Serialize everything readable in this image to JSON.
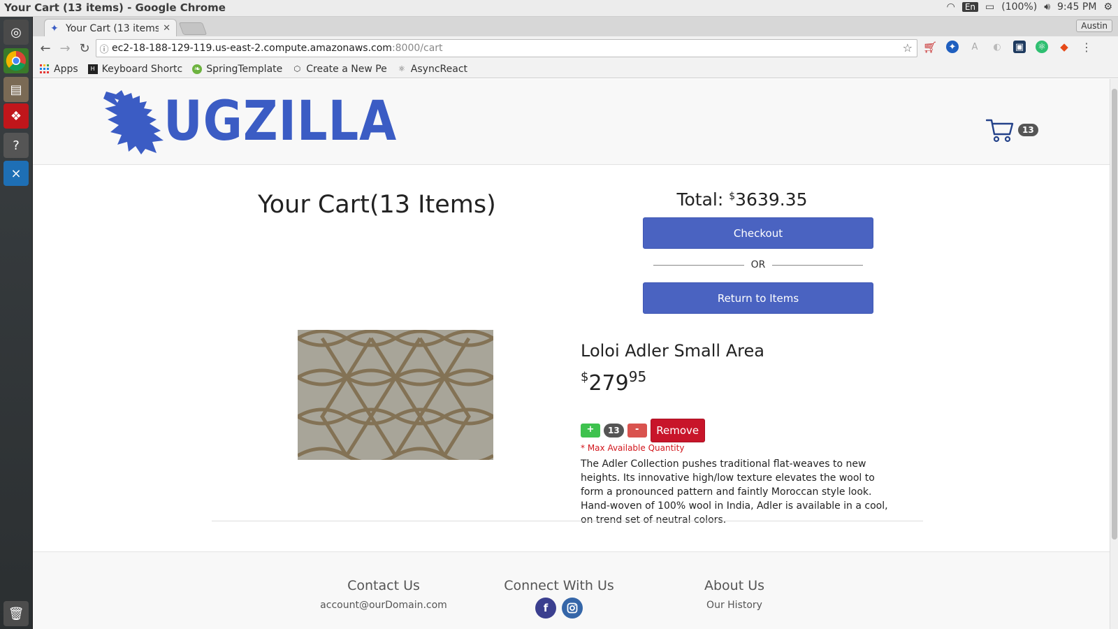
{
  "system": {
    "window_title": "Your Cart (13 items) - Google Chrome",
    "lang": "En",
    "battery": "(100%)",
    "clock": "9:45 PM"
  },
  "browser": {
    "tab_title": "Your Cart (13 items",
    "profile": "Austin",
    "url_host": "ec2-18-188-129-119.us-east-2.compute.amazonaws.com",
    "url_path": ":8000/cart",
    "bookmarks": [
      {
        "label": "Apps"
      },
      {
        "label": "Keyboard Shortc"
      },
      {
        "label": "SpringTemplate"
      },
      {
        "label": "Create a New Pe"
      },
      {
        "label": "AsyncReact"
      }
    ]
  },
  "header": {
    "brand": "UGZILLA",
    "cart_count": "13",
    "brand_color": "#3b5cc4"
  },
  "cart": {
    "title": "Your Cart(13 Items)",
    "total_label": "Total: ",
    "total_currency": "$",
    "total_value": "3639.35",
    "checkout_label": "Checkout",
    "or_label": "OR",
    "return_label": "Return to Items"
  },
  "item": {
    "name": "Loloi Adler Small Area",
    "price_currency": "$",
    "price_whole": "279",
    "price_cents": "95",
    "plus_label": "+",
    "quantity": "13",
    "minus_label": "-",
    "remove_label": "Remove",
    "max_note": "* Max Available Quantity",
    "description": "The Adler Collection pushes traditional flat-weaves to new heights. Its innovative high/low texture elevates the wool to form a pronounced pattern and faintly Moroccan style look. Hand-woven of 100% wool in India, Adler is available in a cool, on trend set of neutral colors."
  },
  "footer": {
    "contact_heading": "Contact Us",
    "contact_email": "account@ourDomain.com",
    "connect_heading": "Connect With Us",
    "facebook_glyph": "f",
    "about_heading": "About Us",
    "about_link": "Our History"
  },
  "colors": {
    "primary_button": "#4a63c1",
    "remove_button": "#c8152a",
    "plus_button": "#3ec24e",
    "minus_button": "#d9534f"
  }
}
